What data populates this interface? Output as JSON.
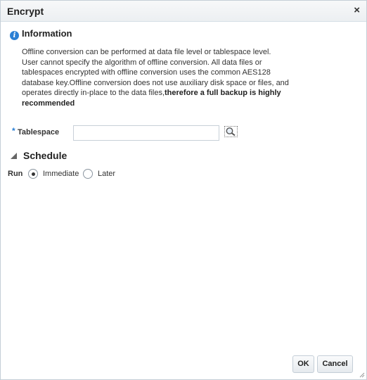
{
  "dialog": {
    "title": "Encrypt",
    "close_glyph": "×"
  },
  "information": {
    "icon": "info-icon",
    "icon_glyph": "i",
    "title": "Information",
    "text_plain": "Offline conversion can be performed at data file level or tablespace level. User cannot specify the algorithm of offline conversion. All data files or tablespaces encrypted with offline conversion uses the common AES128 database key.Offline conversion does not use auxiliary disk space or files, and operates directly in-place to the data files,",
    "text_bold": "therefore a full backup is highly recommended"
  },
  "tablespace": {
    "required_marker": "*",
    "label": "Tablespace",
    "value": "",
    "search_icon": "magnifier-icon"
  },
  "schedule": {
    "title": "Schedule",
    "run_label": "Run",
    "options": [
      {
        "label": "Immediate",
        "selected": true
      },
      {
        "label": "Later",
        "selected": false
      }
    ]
  },
  "buttons": {
    "ok": "OK",
    "cancel": "Cancel"
  },
  "colors": {
    "accent": "#2a7fd4",
    "titlebar": "#eceff2",
    "border": "#c4ced7"
  }
}
